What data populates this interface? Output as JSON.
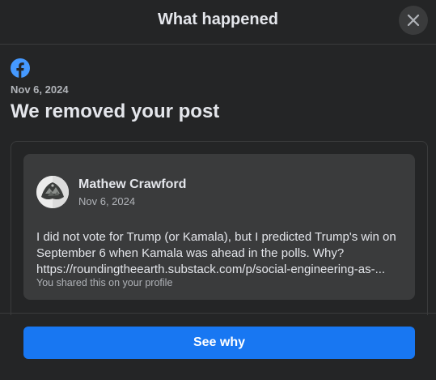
{
  "header": {
    "title": "What happened"
  },
  "notice": {
    "brand_icon": "facebook-icon",
    "date": "Nov 6, 2024",
    "title": "We removed your post"
  },
  "post": {
    "author": "Mathew Crawford",
    "date": "Nov 6, 2024",
    "text_line1": "I did not vote for Trump (or Kamala), but I predicted Trump's win on September 6 when Kamala was ahead in the polls. Why?",
    "link": "https://roundingtheearth.substack.com/p/social-engineering-as-...",
    "shared_note": "You shared this on your profile"
  },
  "actions": {
    "see_why_label": "See why"
  },
  "colors": {
    "background": "#242526",
    "card": "#3a3b3c",
    "accent": "#1877f2",
    "text_primary": "#e4e6eb",
    "text_secondary": "#b0b3b8"
  }
}
